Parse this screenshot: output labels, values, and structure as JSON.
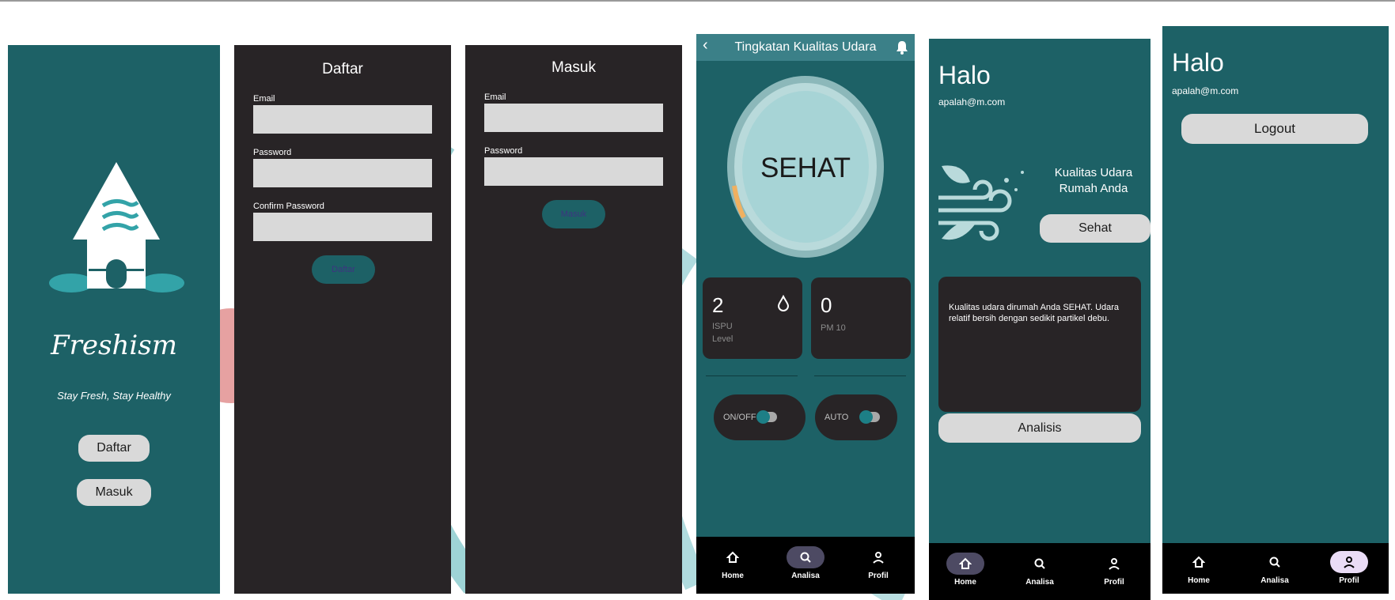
{
  "screens": {
    "splash": {
      "brand": "Freshism",
      "tagline": "Stay Fresh, Stay Healthy",
      "register_label": "Daftar",
      "login_label": "Masuk"
    },
    "register": {
      "title": "Daftar",
      "email_label": "Email",
      "password_label": "Password",
      "confirm_label": "Confirm Password",
      "submit_label": "Daftar"
    },
    "login": {
      "title": "Masuk",
      "email_label": "Email",
      "password_label": "Password",
      "submit_label": "Masuk"
    },
    "analysis": {
      "header_title": "Tingkatan Kualitas Udara",
      "status": "SEHAT",
      "ispu_value": "2",
      "ispu_label": "ISPU",
      "ispu_sublabel": "Level",
      "pm_value": "0",
      "pm_label": "PM 10",
      "switch_power_label": "ON/OFF",
      "switch_auto_label": "AUTO"
    },
    "home": {
      "greeting": "Halo",
      "email": "apalah@m.com",
      "quality_title_1": "Kualitas Udara",
      "quality_title_2": "Rumah Anda",
      "quality_value": "Sehat",
      "description": "Kualitas udara dirumah Anda SEHAT. Udara relatif bersih dengan sedikit partikel debu.",
      "analysis_button": "Analisis"
    },
    "profile": {
      "greeting": "Halo",
      "email": "apalah@m.com",
      "logout_label": "Logout"
    }
  },
  "nav": {
    "home": "Home",
    "analysis": "Analisa",
    "profile": "Profil"
  },
  "colors": {
    "teal": "#1d6166",
    "dark": "#282426",
    "light_gray": "#d9d9d9",
    "accent_orange": "#f0b060",
    "gauge_fill": "#a7d4d6"
  }
}
